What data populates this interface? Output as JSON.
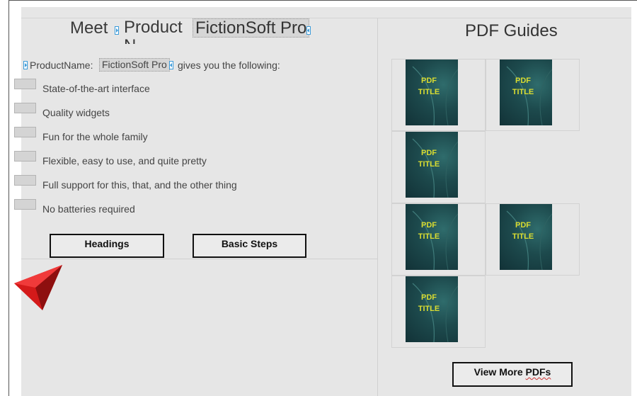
{
  "left_panel": {
    "title_word_meet": "Meet",
    "title_word_product": "Product",
    "title_field_overflow": "N",
    "title_field_value": "FictionSoft Pro",
    "intro_prefix": "ProductName:",
    "intro_field_value": "FictionSoft Pro",
    "intro_suffix": "gives you the following:",
    "features": [
      "State-of-the-art interface",
      "Quality widgets",
      "Fun for the whole family",
      "Flexible, easy to use, and quite pretty",
      "Full support for this, that, and the other thing",
      "No batteries required"
    ],
    "buttons": {
      "headings": "Headings",
      "basic_steps": "Basic Steps"
    }
  },
  "right_panel": {
    "heading": "PDF Guides",
    "cover_line1": "PDF",
    "cover_line2": "TITLE",
    "view_more_prefix": "View More ",
    "view_more_suffix": "PDFs"
  },
  "colors": {
    "page_bg": "#e6e6e6",
    "cover_teal": "#1d4a4d",
    "cover_text": "#d9dc31",
    "tag_marker": "#3a9ad9",
    "pointer_red": "#d41a1a"
  },
  "icons": {
    "pointer": "red-arrow-cursor-icon",
    "tag_open": "tag-open-marker-icon",
    "tag_close": "tag-close-marker-icon"
  }
}
